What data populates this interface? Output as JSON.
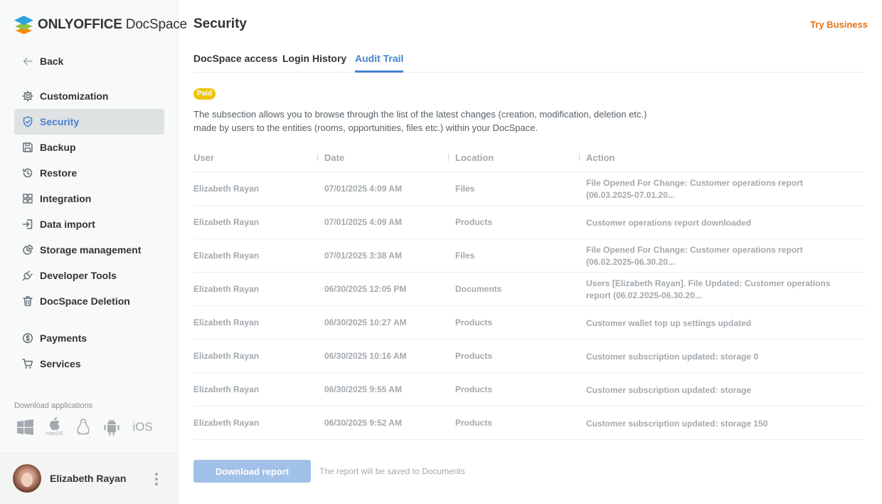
{
  "brand": {
    "name_bold": "ONLYOFFICE",
    "name_regular": "DocSpace",
    "colors": {
      "accent": "#4781d1",
      "try_business": "#e17415",
      "paid": "#edc409"
    }
  },
  "sidebar": {
    "back_label": "Back",
    "items": [
      {
        "label": "Customization",
        "icon": "gear-icon",
        "active": false
      },
      {
        "label": "Security",
        "icon": "shield-icon",
        "active": true
      },
      {
        "label": "Backup",
        "icon": "floppy-icon",
        "active": false
      },
      {
        "label": "Restore",
        "icon": "history-icon",
        "active": false
      },
      {
        "label": "Integration",
        "icon": "grid-icon",
        "active": false
      },
      {
        "label": "Data import",
        "icon": "import-icon",
        "active": false
      },
      {
        "label": "Storage management",
        "icon": "pie-icon",
        "active": false
      },
      {
        "label": "Developer Tools",
        "icon": "plug-icon",
        "active": false
      },
      {
        "label": "DocSpace Deletion",
        "icon": "trash-icon",
        "active": false
      },
      {
        "label": "Payments",
        "icon": "dollar-icon",
        "active": false
      },
      {
        "label": "Services",
        "icon": "cart-icon",
        "active": false
      }
    ],
    "download_title": "Download applications",
    "apps": {
      "macos": "macOS",
      "ios": "iOS"
    },
    "profile_name": "Elizabeth Rayan"
  },
  "header": {
    "title": "Security",
    "try_business": "Try Business"
  },
  "tabs": [
    {
      "label": "DocSpace access",
      "active": false
    },
    {
      "label": "Login History",
      "active": false
    },
    {
      "label": "Audit Trail",
      "active": true
    }
  ],
  "badge": "Paid",
  "description": {
    "line1": "The subsection allows you to browse through the list of the latest changes (creation, modification, deletion etc.)",
    "line2": "made by users to the entities (rooms, opportunities, files etc.) within your DocSpace."
  },
  "table": {
    "columns": [
      "User",
      "Date",
      "Location",
      "Action"
    ],
    "rows": [
      {
        "user": "Elizabeth Rayan",
        "date": "07/01/2025 4:09 AM",
        "location": "Files",
        "action": "File Opened For Change: Customer operations report (06.03.2025-07.01.20..."
      },
      {
        "user": "Elizabeth Rayan",
        "date": "07/01/2025 4:09 AM",
        "location": "Products",
        "action": "Customer operations report downloaded"
      },
      {
        "user": "Elizabeth Rayan",
        "date": "07/01/2025 3:38 AM",
        "location": "Files",
        "action": "File Opened For Change: Customer operations report (06.02.2025-06.30.20..."
      },
      {
        "user": "Elizabeth Rayan",
        "date": "06/30/2025 12:05 PM",
        "location": "Documents",
        "action": "Users [Elizabeth Rayan]. File Updated: Customer operations report (06.02.2025-06.30.20..."
      },
      {
        "user": "Elizabeth Rayan",
        "date": "06/30/2025 10:27 AM",
        "location": "Products",
        "action": "Customer wallet top up settings updated"
      },
      {
        "user": "Elizabeth Rayan",
        "date": "06/30/2025 10:16 AM",
        "location": "Products",
        "action": "Customer subscription updated: storage 0"
      },
      {
        "user": "Elizabeth Rayan",
        "date": "06/30/2025 9:55 AM",
        "location": "Products",
        "action": "Customer subscription updated: storage"
      },
      {
        "user": "Elizabeth Rayan",
        "date": "06/30/2025 9:52 AM",
        "location": "Products",
        "action": "Customer subscription updated: storage 150"
      }
    ]
  },
  "footer": {
    "download_button": "Download report",
    "note": "The report will be saved to Documents"
  }
}
